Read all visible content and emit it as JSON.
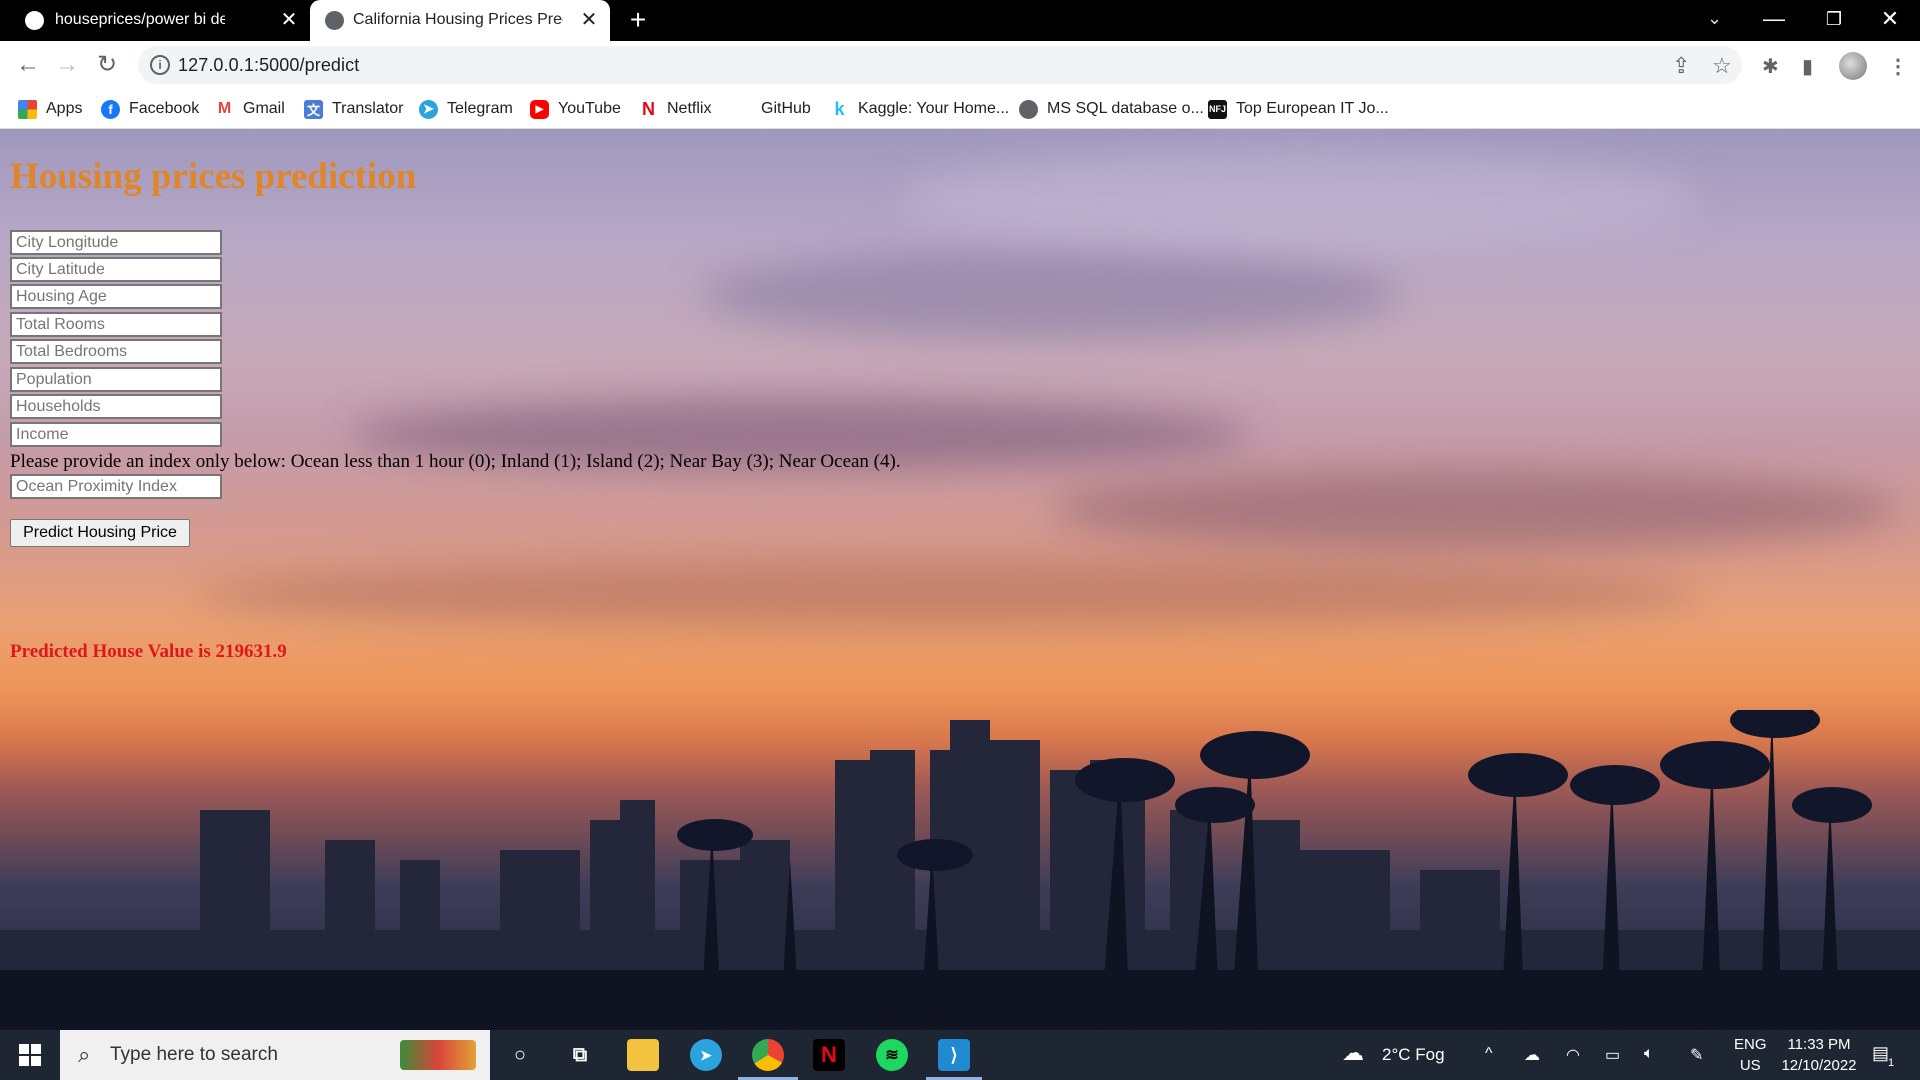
{
  "browser": {
    "tabs": [
      {
        "title": "houseprices/power bi deployed r",
        "icon": "github-icon"
      },
      {
        "title": "California Housing Prices Predicti",
        "icon": "globe-icon"
      }
    ],
    "url": "127.0.0.1:5000/predict",
    "bookmarks": [
      {
        "label": "Apps",
        "icon": "apps-grid-icon"
      },
      {
        "label": "Facebook",
        "icon": "facebook-icon"
      },
      {
        "label": "Gmail",
        "icon": "gmail-icon"
      },
      {
        "label": "Translator",
        "icon": "translator-icon"
      },
      {
        "label": "Telegram",
        "icon": "telegram-icon"
      },
      {
        "label": "YouTube",
        "icon": "youtube-icon"
      },
      {
        "label": "Netflix",
        "icon": "netflix-icon"
      },
      {
        "label": "GitHub",
        "icon": "github-icon"
      },
      {
        "label": "Kaggle: Your Home...",
        "icon": "kaggle-icon"
      },
      {
        "label": "MS SQL database o...",
        "icon": "globe-icon"
      },
      {
        "label": "Top European IT Jo...",
        "icon": "nfj-icon"
      }
    ]
  },
  "page": {
    "heading": "Housing prices prediction",
    "heading_color": "#e0862a",
    "fields": [
      {
        "placeholder": "City Longitude"
      },
      {
        "placeholder": "City Latitude"
      },
      {
        "placeholder": "Housing Age"
      },
      {
        "placeholder": "Total Rooms"
      },
      {
        "placeholder": "Total Bedrooms"
      },
      {
        "placeholder": "Population"
      },
      {
        "placeholder": "Households"
      },
      {
        "placeholder": "Income"
      }
    ],
    "hint": "Please provide an index only below: Ocean less than 1 hour (0); Inland (1); Island (2); Near Bay (3); Near Ocean (4).",
    "ocean_field": {
      "placeholder": "Ocean Proximity Index"
    },
    "button_label": "Predict Housing Price",
    "result": "Predicted House Value is 219631.9",
    "result_color": "#e0161d"
  },
  "taskbar": {
    "search_placeholder": "Type here to search",
    "weather": "2°C  Fog",
    "lang_top": "ENG",
    "lang_bottom": "US",
    "time": "11:33 PM",
    "date": "12/10/2022",
    "notification_count": "1"
  }
}
